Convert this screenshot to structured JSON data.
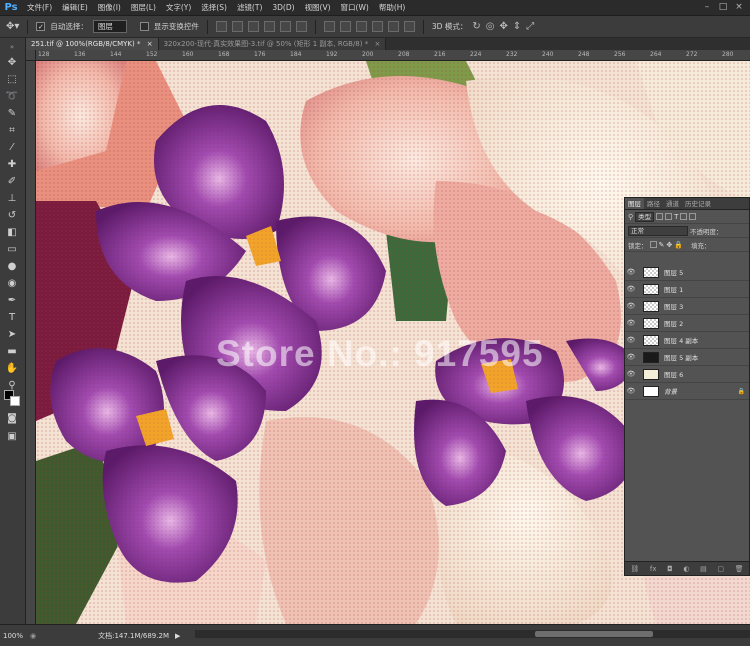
{
  "app": {
    "logo": "Ps",
    "accent": "#4fb0ff"
  },
  "menu": [
    "文件(F)",
    "编辑(E)",
    "图像(I)",
    "图层(L)",
    "文字(Y)",
    "选择(S)",
    "滤镜(T)",
    "3D(D)",
    "视图(V)",
    "窗口(W)",
    "帮助(H)"
  ],
  "window_controls": [
    "–",
    "□",
    "×"
  ],
  "options_bar": {
    "auto_select_label": "自动选择：",
    "auto_select_value": "图层",
    "show_transform_label": "显示变换控件",
    "mode_3d_label": "3D 模式："
  },
  "tabs": [
    {
      "label": "251.tif @ 100%(RGB/8/CMYK) *",
      "close": "×"
    },
    {
      "label": "320x200-现代·真实效果图-3.tif @ 50% (矩形 1 副本, RGB/8) *",
      "close": "×"
    }
  ],
  "ruler_ticks": [
    "128",
    "136",
    "144",
    "152",
    "160",
    "168",
    "176",
    "184",
    "192",
    "200",
    "208",
    "216",
    "224",
    "232",
    "240",
    "248",
    "256",
    "264",
    "272",
    "280",
    "288"
  ],
  "watermark": "Store No.: 917595",
  "layers_panel": {
    "tabs": [
      "图层",
      "路径",
      "通道",
      "历史记录"
    ],
    "kind_label": "类型",
    "blend_mode": "正常",
    "opacity_label": "不透明度：",
    "lock_label": "锁定：",
    "fill_label": "填充：",
    "layers": [
      {
        "name": "图层 5",
        "thumb": "checker"
      },
      {
        "name": "图层 1",
        "thumb": "checker"
      },
      {
        "name": "图层 3",
        "thumb": "checker"
      },
      {
        "name": "图层 2",
        "thumb": "checker"
      },
      {
        "name": "图层 4 副本",
        "thumb": "checker"
      },
      {
        "name": "图层 5 副本",
        "thumb": "dark"
      },
      {
        "name": "图层 6",
        "thumb": "light"
      },
      {
        "name": "背景",
        "thumb": "white",
        "italic": true
      }
    ]
  },
  "status": {
    "zoom": "100%",
    "doc_info": "文档:147.1M/689.2M"
  }
}
